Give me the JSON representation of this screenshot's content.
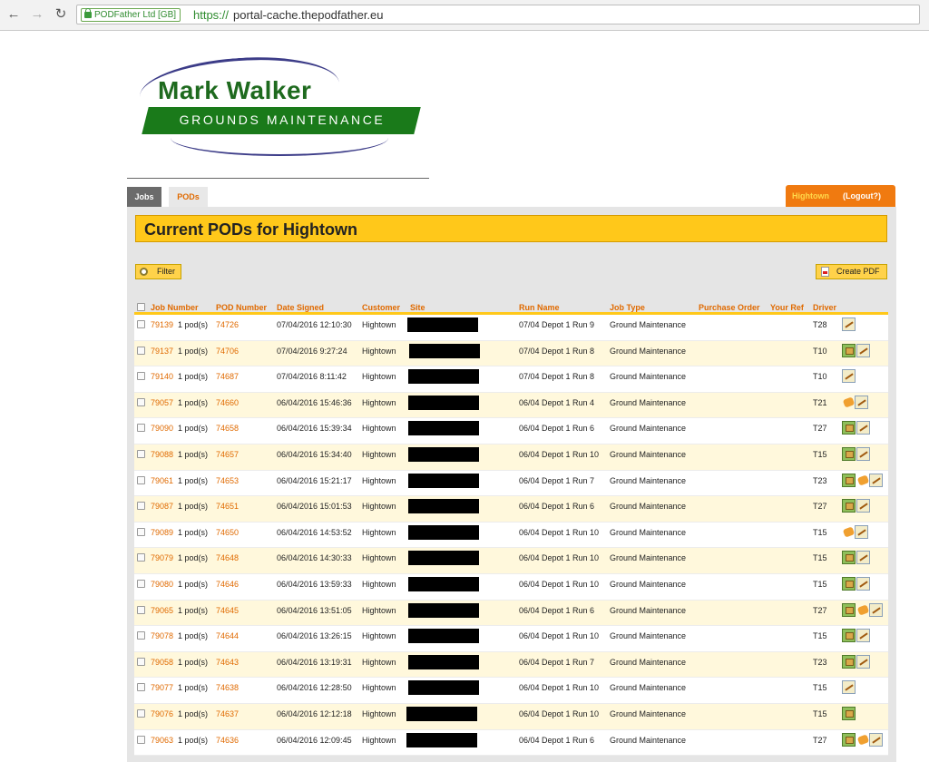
{
  "browser": {
    "ev_badge": "PODFather Ltd [GB]",
    "url_scheme": "https://",
    "url_host": "portal-cache.thepodfather.eu"
  },
  "logo": {
    "title": "Mark Walker",
    "subtitle": "GROUNDS MAINTENANCE"
  },
  "tabs": {
    "jobs": "Jobs",
    "pods": "PODs"
  },
  "account": {
    "user": "Hightown",
    "logout": "(Logout?)"
  },
  "page": {
    "title": "Current PODs for Hightown",
    "filter_label": "Filter",
    "create_pdf_label": "Create PDF"
  },
  "table": {
    "columns": [
      "Job Number",
      "POD Number",
      "Date Signed",
      "Customer",
      "Site",
      "Run Name",
      "Job Type",
      "Purchase Order",
      "Your Ref",
      "Driver"
    ],
    "rows": [
      {
        "job": "79139",
        "pods": "1 pod(s)",
        "pod": "74726",
        "date": "07/04/2016 12:10:30",
        "customer": "Hightown",
        "run": "07/04 Depot 1 Run 9",
        "type": "Ground Maintenance",
        "driver": "T28",
        "icons": [
          "signature-icon"
        ]
      },
      {
        "job": "79137",
        "pods": "1 pod(s)",
        "pod": "74706",
        "date": "07/04/2016 9:27:24",
        "customer": "Hightown",
        "run": "07/04 Depot 1 Run 8",
        "type": "Ground Maintenance",
        "driver": "T10",
        "icons": [
          "photo-icon",
          "signature-icon"
        ]
      },
      {
        "job": "79140",
        "pods": "1 pod(s)",
        "pod": "74687",
        "date": "07/04/2016 8:11:42",
        "customer": "Hightown",
        "run": "07/04 Depot 1 Run 8",
        "type": "Ground Maintenance",
        "driver": "T10",
        "icons": [
          "signature-icon"
        ]
      },
      {
        "job": "79057",
        "pods": "1 pod(s)",
        "pod": "74660",
        "date": "06/04/2016 15:46:36",
        "customer": "Hightown",
        "run": "06/04 Depot 1 Run 4",
        "type": "Ground Maintenance",
        "driver": "T21",
        "icons": [
          "hand-icon",
          "signature-icon"
        ]
      },
      {
        "job": "79090",
        "pods": "1 pod(s)",
        "pod": "74658",
        "date": "06/04/2016 15:39:34",
        "customer": "Hightown",
        "run": "06/04 Depot 1 Run 6",
        "type": "Ground Maintenance",
        "driver": "T27",
        "icons": [
          "photo-icon",
          "signature-icon"
        ]
      },
      {
        "job": "79088",
        "pods": "1 pod(s)",
        "pod": "74657",
        "date": "06/04/2016 15:34:40",
        "customer": "Hightown",
        "run": "06/04 Depot 1 Run 10",
        "type": "Ground Maintenance",
        "driver": "T15",
        "icons": [
          "photo-icon",
          "signature-icon"
        ]
      },
      {
        "job": "79061",
        "pods": "1 pod(s)",
        "pod": "74653",
        "date": "06/04/2016 15:21:17",
        "customer": "Hightown",
        "run": "06/04 Depot 1 Run 7",
        "type": "Ground Maintenance",
        "driver": "T23",
        "icons": [
          "photo-icon",
          "hand-icon",
          "signature-icon"
        ]
      },
      {
        "job": "79087",
        "pods": "1 pod(s)",
        "pod": "74651",
        "date": "06/04/2016 15:01:53",
        "customer": "Hightown",
        "run": "06/04 Depot 1 Run 6",
        "type": "Ground Maintenance",
        "driver": "T27",
        "icons": [
          "photo-icon",
          "signature-icon"
        ]
      },
      {
        "job": "79089",
        "pods": "1 pod(s)",
        "pod": "74650",
        "date": "06/04/2016 14:53:52",
        "customer": "Hightown",
        "run": "06/04 Depot 1 Run 10",
        "type": "Ground Maintenance",
        "driver": "T15",
        "icons": [
          "hand-icon",
          "signature-icon"
        ]
      },
      {
        "job": "79079",
        "pods": "1 pod(s)",
        "pod": "74648",
        "date": "06/04/2016 14:30:33",
        "customer": "Hightown",
        "run": "06/04 Depot 1 Run 10",
        "type": "Ground Maintenance",
        "driver": "T15",
        "icons": [
          "photo-icon",
          "signature-icon"
        ]
      },
      {
        "job": "79080",
        "pods": "1 pod(s)",
        "pod": "74646",
        "date": "06/04/2016 13:59:33",
        "customer": "Hightown",
        "run": "06/04 Depot 1 Run 10",
        "type": "Ground Maintenance",
        "driver": "T15",
        "icons": [
          "photo-icon",
          "signature-icon"
        ]
      },
      {
        "job": "79065",
        "pods": "1 pod(s)",
        "pod": "74645",
        "date": "06/04/2016 13:51:05",
        "customer": "Hightown",
        "run": "06/04 Depot 1 Run 6",
        "type": "Ground Maintenance",
        "driver": "T27",
        "icons": [
          "photo-icon",
          "hand-icon",
          "signature-icon"
        ]
      },
      {
        "job": "79078",
        "pods": "1 pod(s)",
        "pod": "74644",
        "date": "06/04/2016 13:26:15",
        "customer": "Hightown",
        "run": "06/04 Depot 1 Run 10",
        "type": "Ground Maintenance",
        "driver": "T15",
        "icons": [
          "photo-icon",
          "signature-icon"
        ]
      },
      {
        "job": "79058",
        "pods": "1 pod(s)",
        "pod": "74643",
        "date": "06/04/2016 13:19:31",
        "customer": "Hightown",
        "run": "06/04 Depot 1 Run 7",
        "type": "Ground Maintenance",
        "driver": "T23",
        "icons": [
          "photo-icon",
          "signature-icon"
        ]
      },
      {
        "job": "79077",
        "pods": "1 pod(s)",
        "pod": "74638",
        "date": "06/04/2016 12:28:50",
        "customer": "Hightown",
        "run": "06/04 Depot 1 Run 10",
        "type": "Ground Maintenance",
        "driver": "T15",
        "icons": [
          "signature-icon"
        ]
      },
      {
        "job": "79076",
        "pods": "1 pod(s)",
        "pod": "74637",
        "date": "06/04/2016 12:12:18",
        "customer": "Hightown",
        "run": "06/04 Depot 1 Run 10",
        "type": "Ground Maintenance",
        "driver": "T15",
        "icons": [
          "photo-icon"
        ]
      },
      {
        "job": "79063",
        "pods": "1 pod(s)",
        "pod": "74636",
        "date": "06/04/2016 12:09:45",
        "customer": "Hightown",
        "run": "06/04 Depot 1 Run 6",
        "type": "Ground Maintenance",
        "driver": "T27",
        "icons": [
          "photo-icon",
          "hand-icon",
          "signature-icon"
        ]
      }
    ]
  }
}
